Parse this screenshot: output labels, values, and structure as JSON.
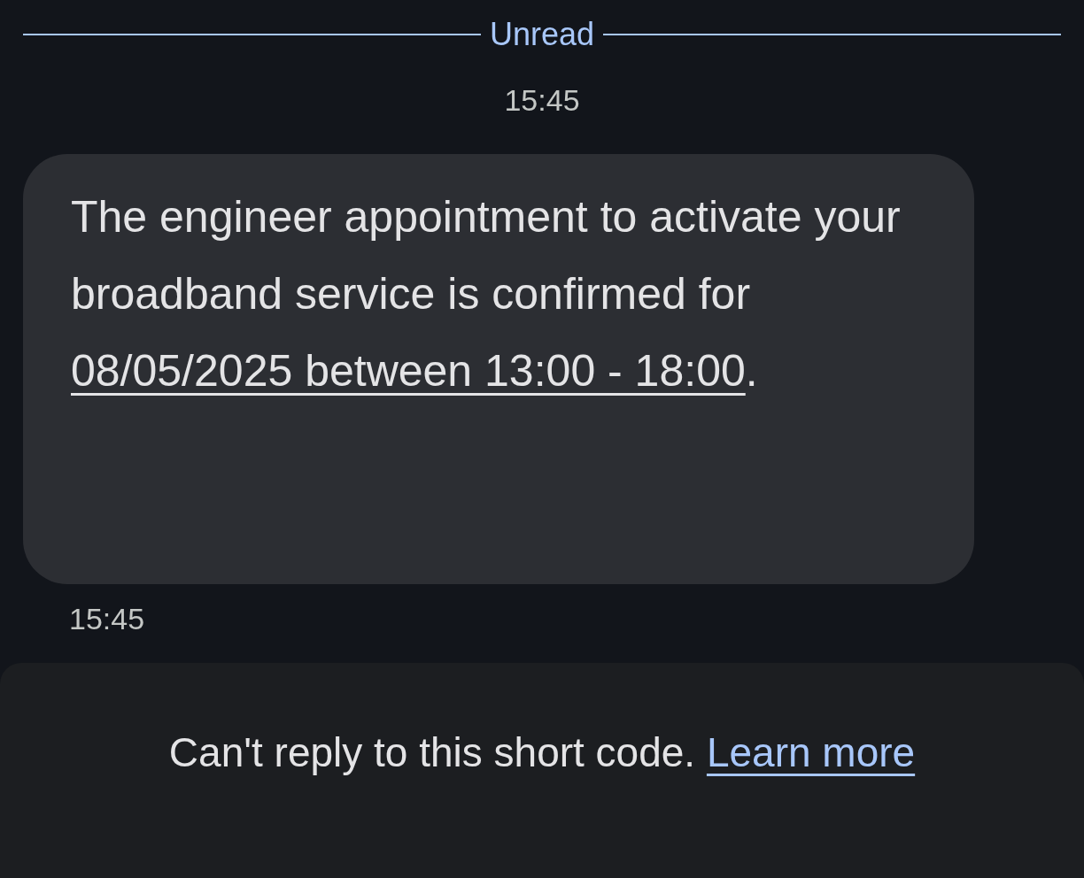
{
  "divider": {
    "label": "Unread"
  },
  "timestamp": "15:45",
  "message": {
    "text": "The engineer appointment to activate your broadband service is confirmed for ",
    "link": "08/05/2025 between 13:00 - 18:00",
    "after": "."
  },
  "message_time": "15:45",
  "footer": {
    "text": "Can't reply to this short code. ",
    "link": "Learn more"
  }
}
